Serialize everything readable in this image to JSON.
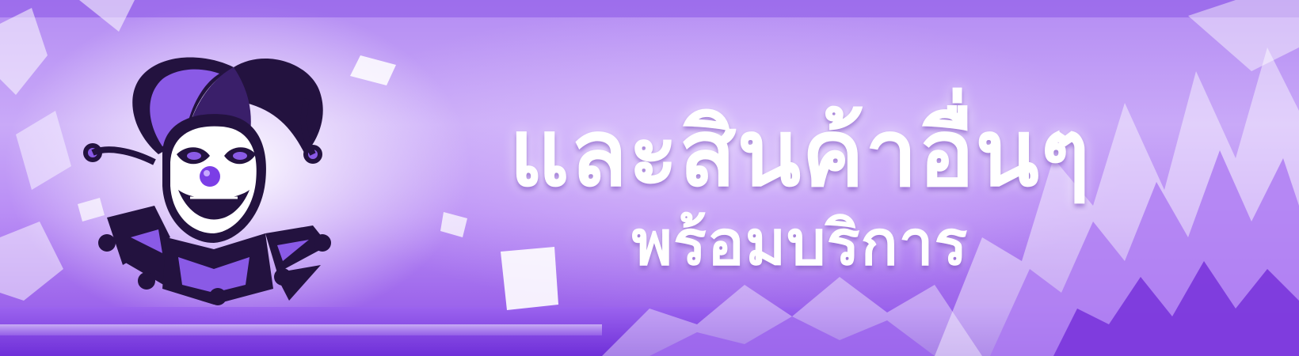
{
  "banner": {
    "headline_line1": "และสินค้าอื่นๆ",
    "headline_line2": "พร้อมบริการ",
    "mascot_icon": "jester-mascot-icon",
    "colors": {
      "primary_purple": "#8d4fe6",
      "light_purple": "#c9a9f8",
      "jester_dark": "#23123f",
      "jester_accent": "#8a5ae6",
      "text": "#ffffff"
    }
  }
}
